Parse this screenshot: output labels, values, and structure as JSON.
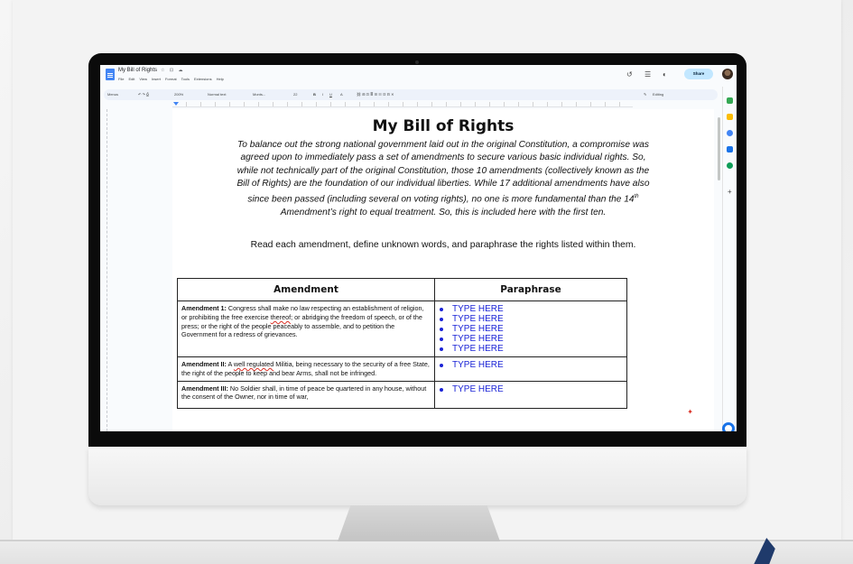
{
  "window": {
    "doc_title": "My Bill of Rights",
    "title_icons": "☆ ⊡ ☁",
    "menu": [
      "File",
      "Edit",
      "View",
      "Insert",
      "Format",
      "Tools",
      "Extensions",
      "Help"
    ],
    "share_label": "Share"
  },
  "toolbar": {
    "menus": "Menus",
    "zoom": "200%",
    "style": "Normal text",
    "font": "Monts...",
    "size": "22",
    "editing": "Editing"
  },
  "document": {
    "heading": "My Bill of Rights",
    "intro_lines": [
      "To balance out the strong national government laid out in the original Constitution, a compromise was",
      "agreed upon to immediately pass a set of amendments to secure various basic individual rights. So,",
      "while not technically part of the original Constitution, those 10 amendments (collectively known as the",
      "Bill of Rights) are the foundation of our individual liberties. While 17 additional amendments have also",
      "since been passed (including several on voting rights), no one is more fundamental than the 14",
      "Amendment’s right to equal treatment. So, this is included here with the first ten."
    ],
    "intro_sup": "th",
    "instruction": "Read each amendment, define unknown words, and paraphrase the rights listed within them.",
    "table": {
      "headers": [
        "Amendment",
        "Paraphrase"
      ],
      "rows": [
        {
          "label": "Amendment 1:",
          "text_a": " Congress shall make no law respecting an establishment of religion, or prohibiting the free exercise ",
          "flag": "thereof",
          "text_b": "; or abridging the freedom of speech, or of the press; or the right of the people peaceably to assemble, and to petition the Government for a redress of grievances.",
          "bullets": [
            "TYPE HERE",
            "TYPE HERE",
            "TYPE HERE",
            "TYPE HERE",
            "TYPE HERE"
          ]
        },
        {
          "label": "Amendment II:",
          "text_a": " A ",
          "flag": "well regulated",
          "text_b": " Militia, being necessary to the security of a free State, the right of the people to keep and bear Arms, shall not be infringed.",
          "bullets": [
            "TYPE HERE"
          ]
        },
        {
          "label": "Amendment III:",
          "text_a": " No Soldier shall, in time of peace be quartered in any house, without the consent of the Owner, nor in time of war,",
          "flag": "",
          "text_b": "",
          "bullets": [
            "TYPE HERE"
          ]
        }
      ]
    }
  },
  "colors": {
    "bullet_text": "#1a23d6",
    "share_bg": "#c2e7ff",
    "docs_blue": "#4285f4"
  },
  "icons": [
    "docs-icon",
    "history-icon",
    "comment-icon",
    "meet-icon",
    "avatar",
    "apple-logo-icon",
    "pencil-icon",
    "undo-icon",
    "redo-icon",
    "print-icon"
  ]
}
